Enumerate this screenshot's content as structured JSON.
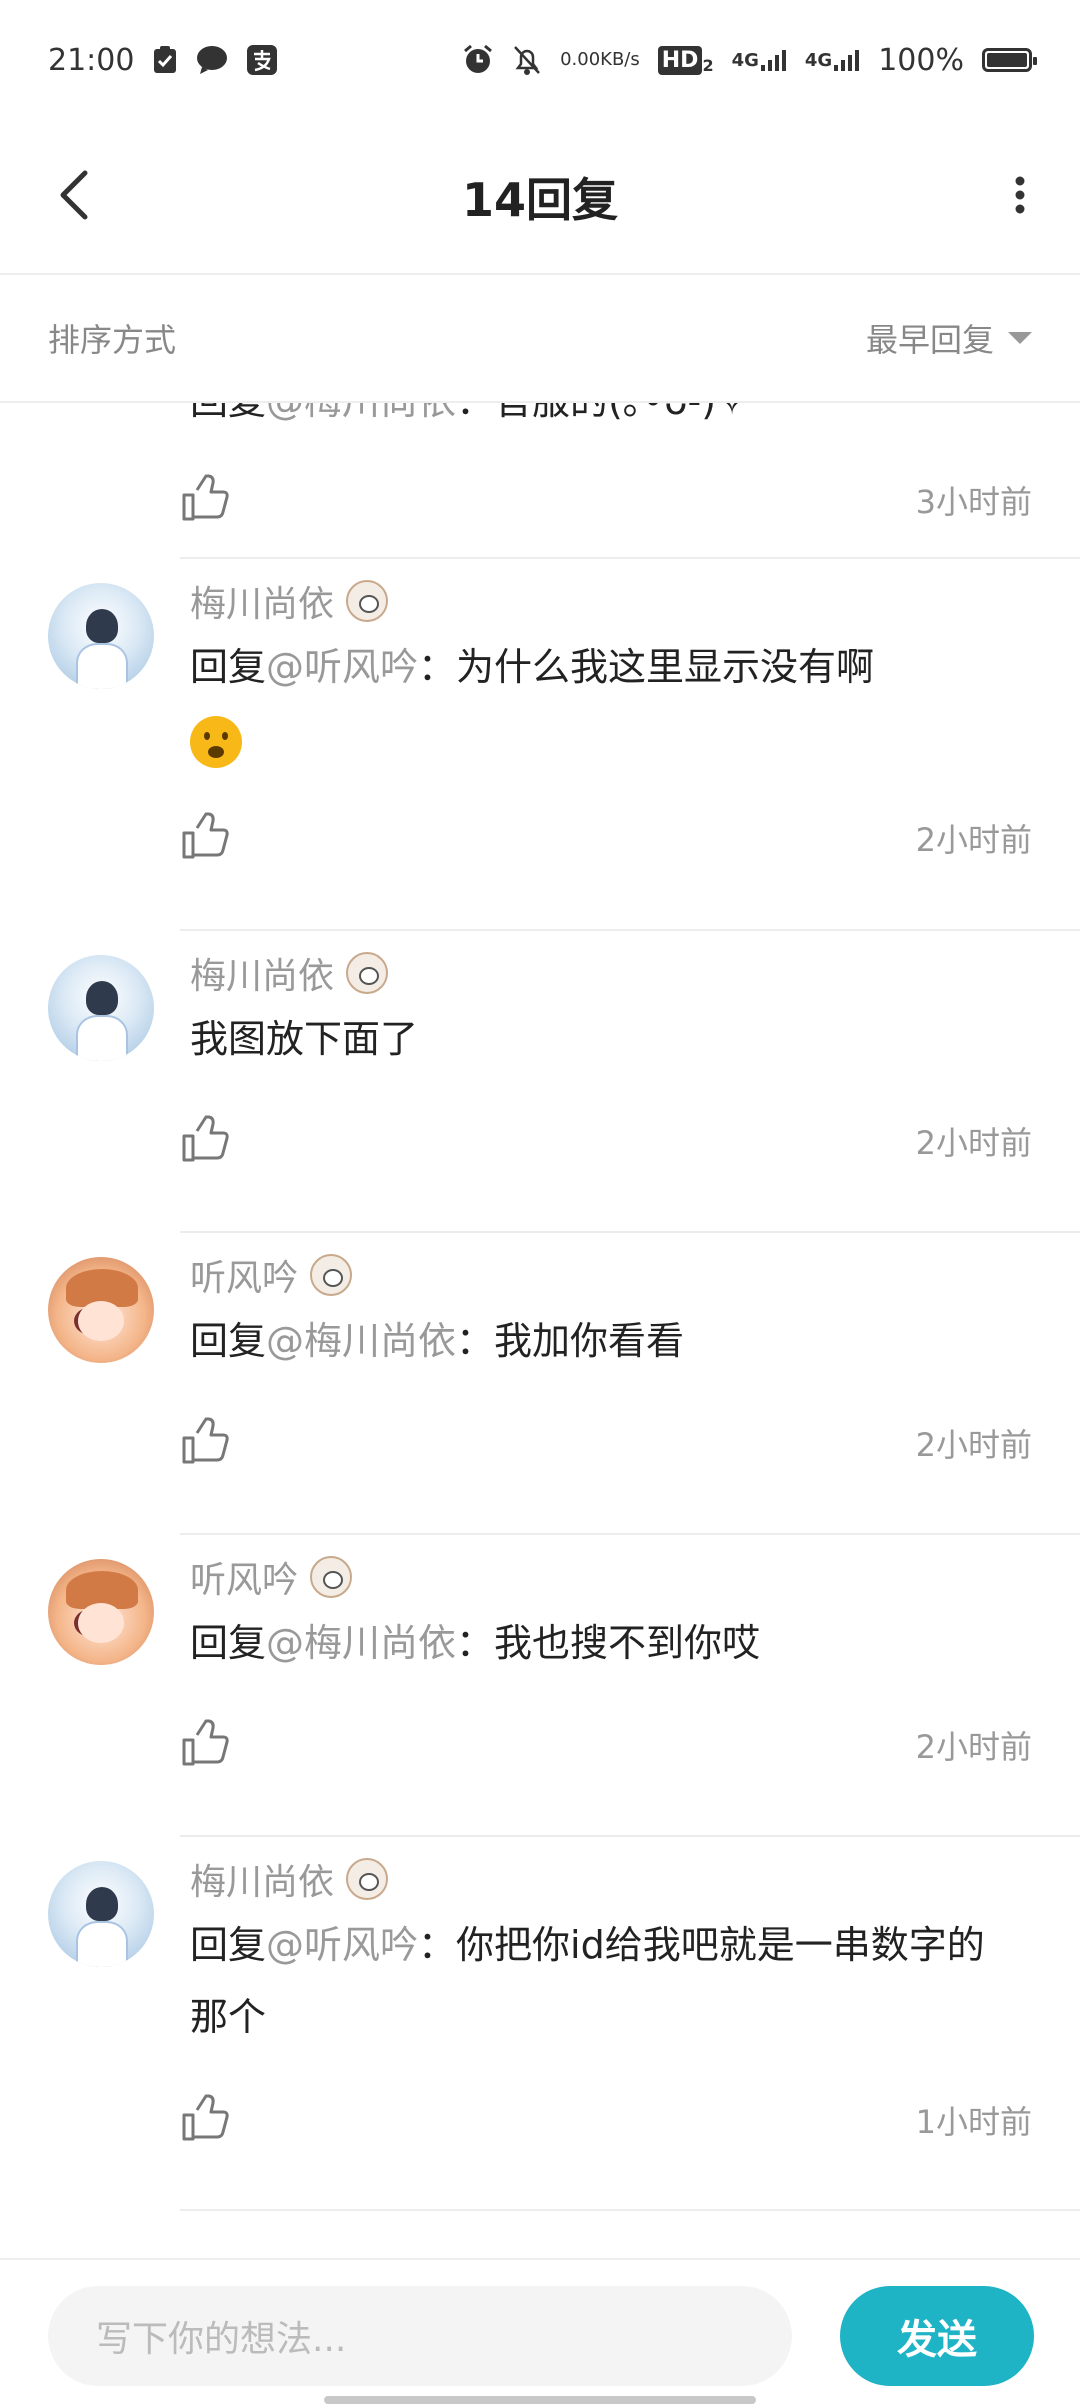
{
  "status_bar": {
    "time": "21:00",
    "net_speed": "0.00",
    "net_unit": "KB/s",
    "hd_label": "HD",
    "hd_sub": "2",
    "sig1": "4G",
    "sig2": "4G",
    "battery": "100%"
  },
  "header": {
    "title": "14回复"
  },
  "sort": {
    "label": "排序方式",
    "value": "最早回复"
  },
  "comments": [
    {
      "reply_prefix": "回复",
      "mention": "@梅川尚依",
      "colon": "：",
      "body": "官服的(｡•̀ᴗ-)✧",
      "time": "3小时前"
    },
    {
      "user": "梅川尚依",
      "reply_prefix": "回复",
      "mention": "@听风吟",
      "colon": "：",
      "body": "为什么我这里显示没有啊",
      "emoji": "frowning-face",
      "time": "2小时前"
    },
    {
      "user": "梅川尚依",
      "body": "我图放下面了",
      "time": "2小时前"
    },
    {
      "user": "听风吟",
      "reply_prefix": "回复",
      "mention": "@梅川尚依",
      "colon": "：",
      "body": "我加你看看",
      "time": "2小时前"
    },
    {
      "user": "听风吟",
      "reply_prefix": "回复",
      "mention": "@梅川尚依",
      "colon": "：",
      "body": "我也搜不到你哎",
      "time": "2小时前"
    },
    {
      "user": "梅川尚依",
      "reply_prefix": "回复",
      "mention": "@听风吟",
      "colon": "：",
      "body": "你把你id给我吧就是一串数字的那个",
      "time": "1小时前"
    }
  ],
  "input": {
    "placeholder": "写下你的想法..."
  },
  "send_button": {
    "label": "发送"
  },
  "colors": {
    "accent": "#1fb3c6",
    "muted": "#999999"
  }
}
